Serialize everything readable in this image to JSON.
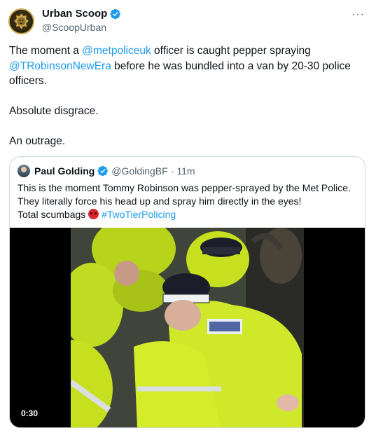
{
  "author": {
    "display_name": "Urban Scoop",
    "handle": "@ScoopUrban",
    "more_label": "···"
  },
  "tweet": {
    "line1_pre": "The moment a ",
    "mention1": "@metpoliceuk",
    "line1_post": " officer is caught pepper spraying",
    "mention2": "@TRobinsonNewEra",
    "line2_post": " before he was bundled into a van by 20-30 police officers.",
    "para2": "Absolute disgrace.",
    "para3": "An outrage."
  },
  "quote": {
    "display_name": "Paul Golding",
    "handle": "@GoldingBF",
    "separator": " · ",
    "time": "11m",
    "line1": "This is the moment Tommy Robinson was pepper-sprayed by the Met Police.",
    "line2": "They literally force his head up and spray him directly in the eyes!",
    "line3_pre": "Total scumbags ",
    "hashtag": "#TwoTierPolicing",
    "video_duration": "0:30"
  },
  "icons": {
    "verified": "verified-badge-icon",
    "more": "more-options-icon",
    "emoji": "angry-face-icon"
  },
  "colors": {
    "link": "#1d9bf0",
    "verified": "#1d9bf0",
    "secondary_text": "#536471",
    "border": "#cfd9de",
    "hi_vis": "#d4f01e"
  }
}
